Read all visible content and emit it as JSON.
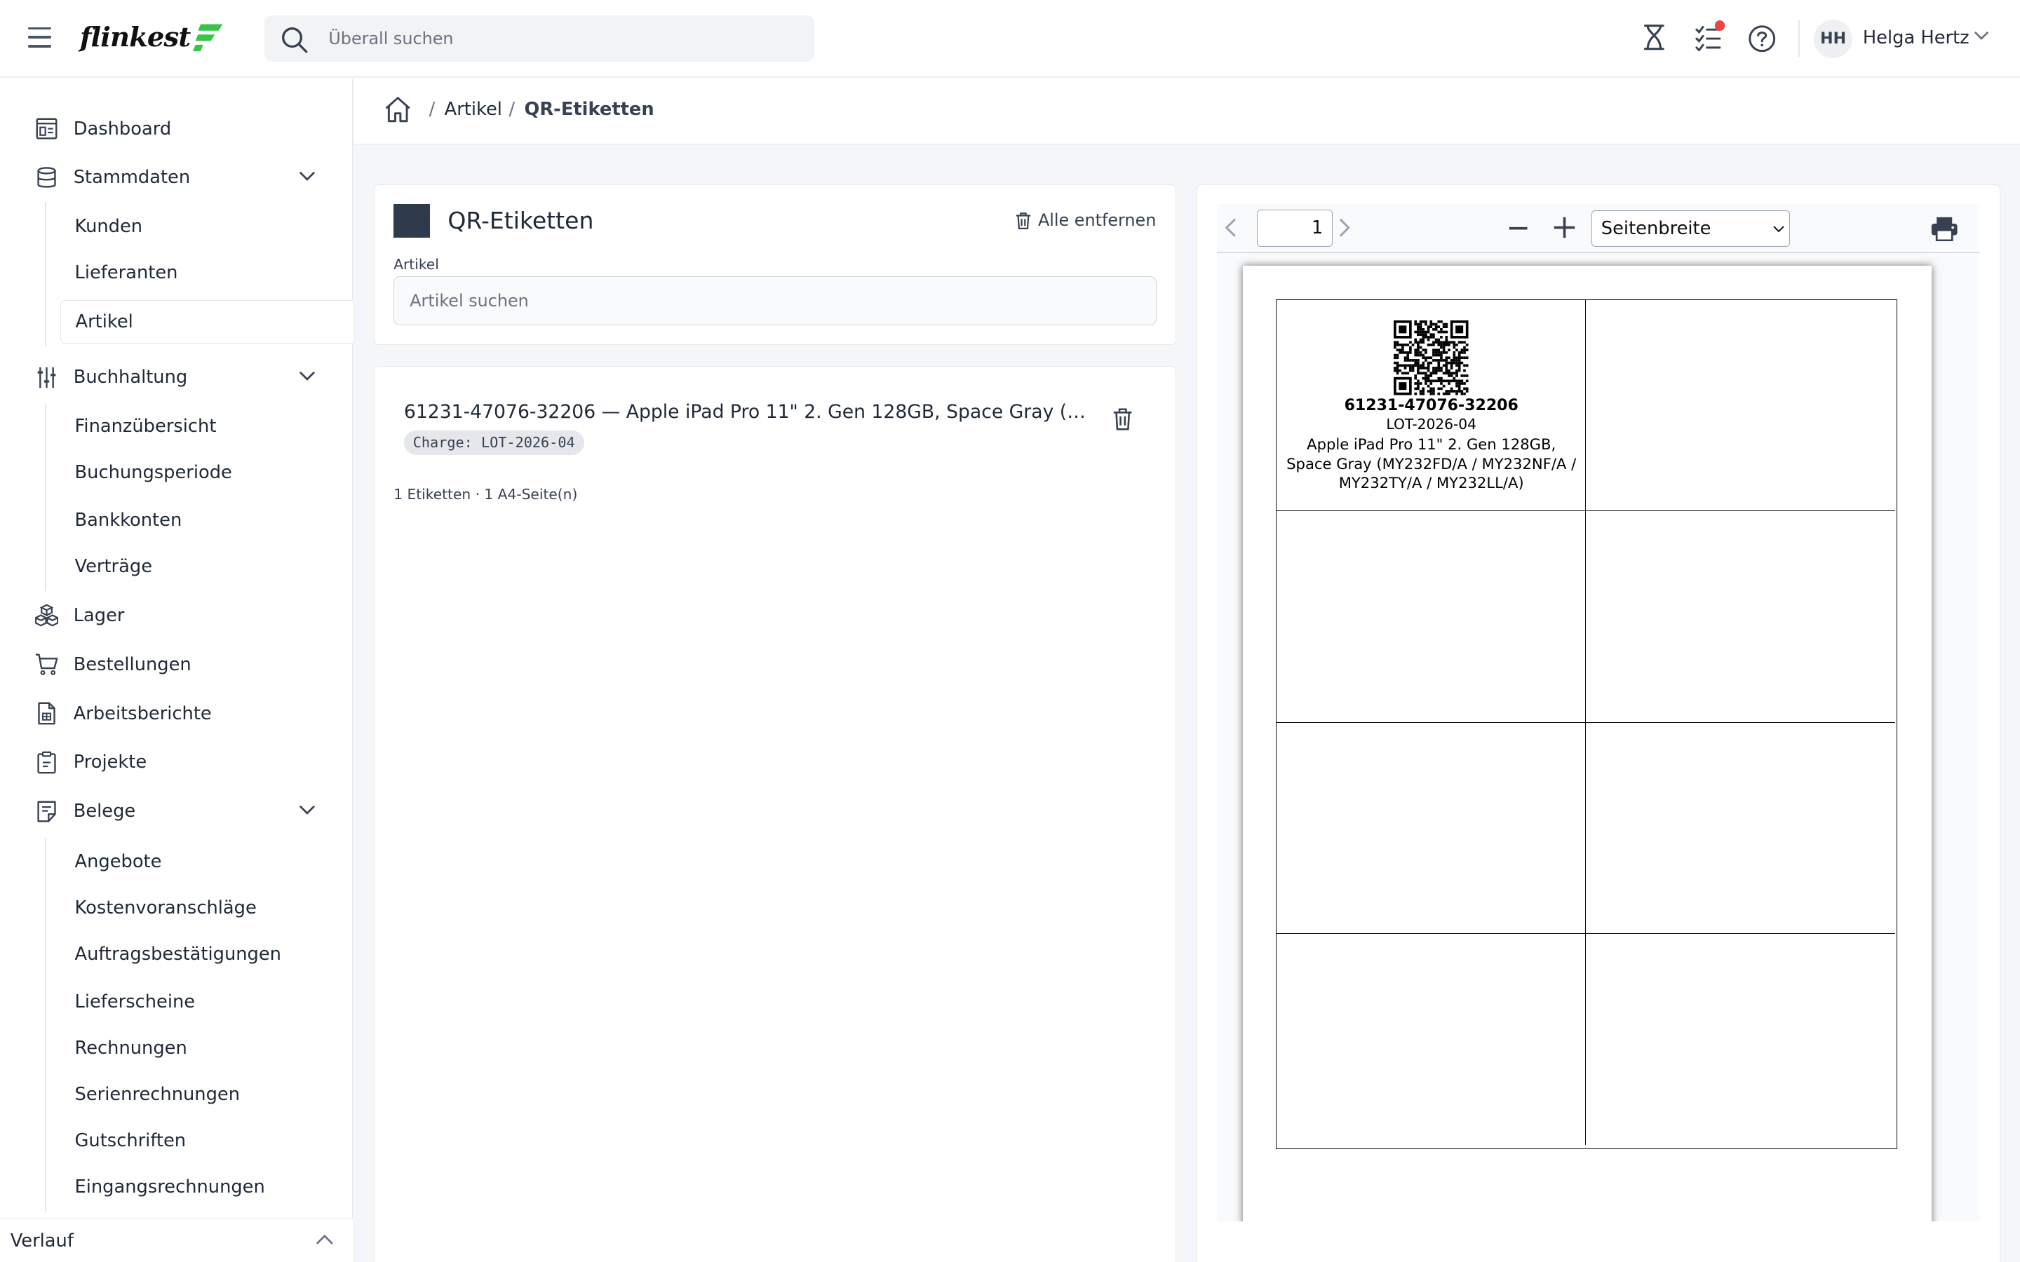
{
  "header": {
    "logo_text": "flinkest",
    "search_placeholder": "Überall suchen",
    "user_initials": "HH",
    "user_name": "Helga Hertz",
    "icons": [
      "menu-icon",
      "hourglass-icon",
      "checklist-icon",
      "help-icon",
      "chevron-down-icon"
    ],
    "accent_color": "#39c34a",
    "notification_dot_color": "#ef4444"
  },
  "sidebar": {
    "items": [
      {
        "label": "Dashboard",
        "icon": "dashboard-icon"
      },
      {
        "label": "Stammdaten",
        "icon": "database-icon",
        "expanded": true,
        "children": [
          {
            "label": "Kunden"
          },
          {
            "label": "Lieferanten"
          },
          {
            "label": "Artikel",
            "active": true
          }
        ]
      },
      {
        "label": "Buchhaltung",
        "icon": "sliders-icon",
        "expanded": true,
        "children": [
          {
            "label": "Finanzübersicht"
          },
          {
            "label": "Buchungsperiode"
          },
          {
            "label": "Bankkonten"
          },
          {
            "label": "Verträge"
          }
        ]
      },
      {
        "label": "Lager",
        "icon": "boxes-icon"
      },
      {
        "label": "Bestellungen",
        "icon": "cart-icon"
      },
      {
        "label": "Arbeitsberichte",
        "icon": "report-icon"
      },
      {
        "label": "Projekte",
        "icon": "clipboard-icon"
      },
      {
        "label": "Belege",
        "icon": "receipt-icon",
        "expanded": true,
        "children": [
          {
            "label": "Angebote"
          },
          {
            "label": "Kostenvoranschläge"
          },
          {
            "label": "Auftragsbestätigungen"
          },
          {
            "label": "Lieferscheine"
          },
          {
            "label": "Rechnungen"
          },
          {
            "label": "Serienrechnungen"
          },
          {
            "label": "Gutschriften"
          },
          {
            "label": "Eingangsrechnungen"
          }
        ]
      }
    ],
    "footer_label": "Verlauf"
  },
  "breadcrumb": [
    "Artikel",
    "QR-Etiketten"
  ],
  "labels_panel": {
    "title": "QR-Etiketten",
    "remove_all": "Alle entfernen",
    "field_label": "Artikel",
    "field_placeholder": "Artikel suchen",
    "swatch_color": "#2f3a4d"
  },
  "items_panel": {
    "item_title": "61231-47076-32206 — Apple iPad Pro 11\" 2. Gen 128GB, Space Gray (MY232FD/A / MY232NF/A / MY232TY/A / MY232LL/A)",
    "item_badge": "Charge: LOT-2026-04",
    "summary": "1 Etiketten · 1 A4-Seite(n)"
  },
  "preview": {
    "page_number": "1",
    "zoom_options": [
      "Seitenbreite"
    ],
    "zoom_selected": "Seitenbreite",
    "label": {
      "code": "61231-47076-32206",
      "lot": "LOT-2026-04",
      "name": "Apple iPad Pro 11\" 2. Gen 128GB, Space Gray (MY232FD/A / MY232NF/A / MY232TY/A / MY232LL/A)"
    }
  }
}
